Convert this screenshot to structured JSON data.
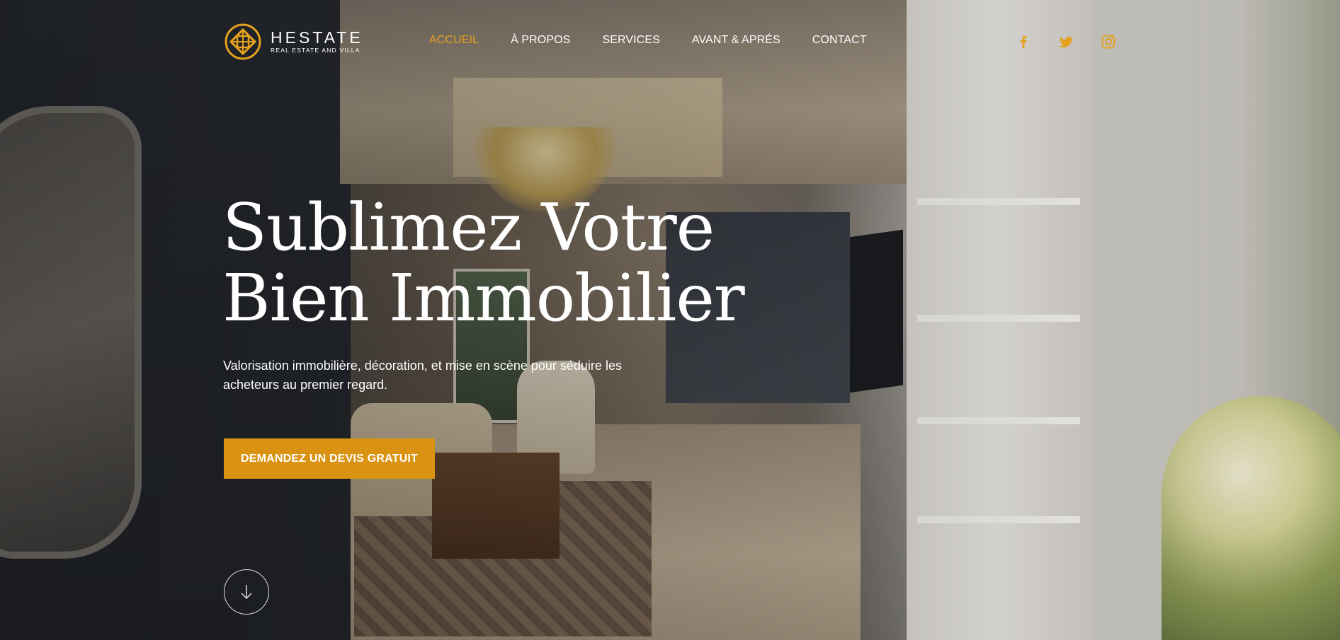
{
  "brand": {
    "name": "HESTATE",
    "tagline": "REAL ESTATE AND VILLA",
    "accent_color": "#e4a21e",
    "logo_icon": "celtic-knot-logo-icon"
  },
  "nav": {
    "items": [
      {
        "label": "ACCUEIL",
        "active": true
      },
      {
        "label": "À PROPOS",
        "active": false
      },
      {
        "label": "SERVICES",
        "active": false
      },
      {
        "label": "AVANT & APRÉS",
        "active": false
      },
      {
        "label": "CONTACT",
        "active": false
      }
    ]
  },
  "social": {
    "icons": [
      "facebook-icon",
      "twitter-icon",
      "instagram-icon"
    ],
    "color": "#e4a21e"
  },
  "hero": {
    "headline_line1": "Sublimez Votre",
    "headline_line2": "Bien Immobilier",
    "subtitle": "Valorisation immobilière, décoration, et mise en scène pour séduire les acheteurs au premier regard.",
    "cta_label": "DEMANDEZ UN DEVIS GRATUIT",
    "cta_color": "#d99211",
    "scroll_icon": "arrow-down-icon"
  }
}
